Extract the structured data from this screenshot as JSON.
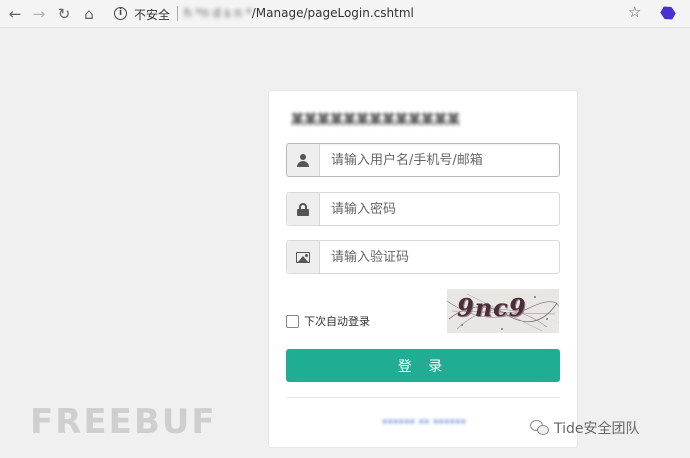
{
  "browser": {
    "insecure_label": "不安全",
    "url_host": "h  *n  d  s  n  *",
    "url_path": "/Manage/pageLogin.cshtml"
  },
  "login": {
    "title": "某某某某某某某某某某某某某",
    "username_placeholder": "请输入用户名/手机号/邮箱",
    "password_placeholder": "请输入密码",
    "captcha_placeholder": "请输入验证码",
    "remember_label": "下次自动登录",
    "captcha_text": "9nc9",
    "login_button": "登 录",
    "bottom_link": "****** ** ******"
  },
  "watermark": {
    "left": "FREEBUF",
    "right": "Tide安全团队"
  },
  "colors": {
    "accent": "#1fae94",
    "page_bg": "#f0f0f0"
  }
}
